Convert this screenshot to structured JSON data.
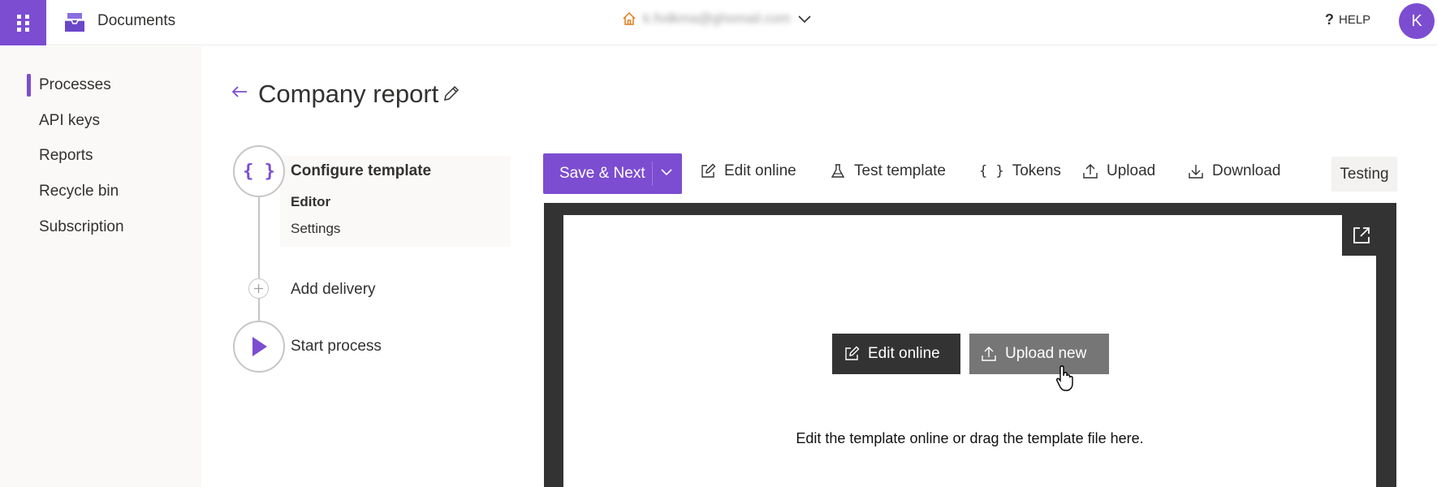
{
  "app": {
    "name": "Documents",
    "tenant_email": "k.fvdkma@ghomail.com",
    "help_label": "HELP",
    "avatar_initial": "K",
    "brand_color": "#7c4dd1"
  },
  "nav": {
    "items": [
      {
        "label": "Processes",
        "active": true
      },
      {
        "label": "API keys"
      },
      {
        "label": "Reports"
      },
      {
        "label": "Recycle bin"
      },
      {
        "label": "Subscription"
      }
    ]
  },
  "page": {
    "title": "Company report"
  },
  "stepper": {
    "configure": {
      "title": "Configure template",
      "sub_active": "Editor",
      "sub_inactive": "Settings",
      "icon": "braces-icon"
    },
    "add_delivery": {
      "label": "Add delivery",
      "icon": "plus-icon"
    },
    "start_process": {
      "label": "Start process",
      "icon": "play-icon"
    }
  },
  "toolbar": {
    "save_next": "Save & Next",
    "edit_online": "Edit online",
    "test_template": "Test template",
    "tokens": "Tokens",
    "upload": "Upload",
    "download": "Download",
    "testing": "Testing"
  },
  "editor": {
    "edit_online_button": "Edit online",
    "upload_new_button": "Upload new",
    "hint": "Edit the template online or drag the template file here."
  }
}
